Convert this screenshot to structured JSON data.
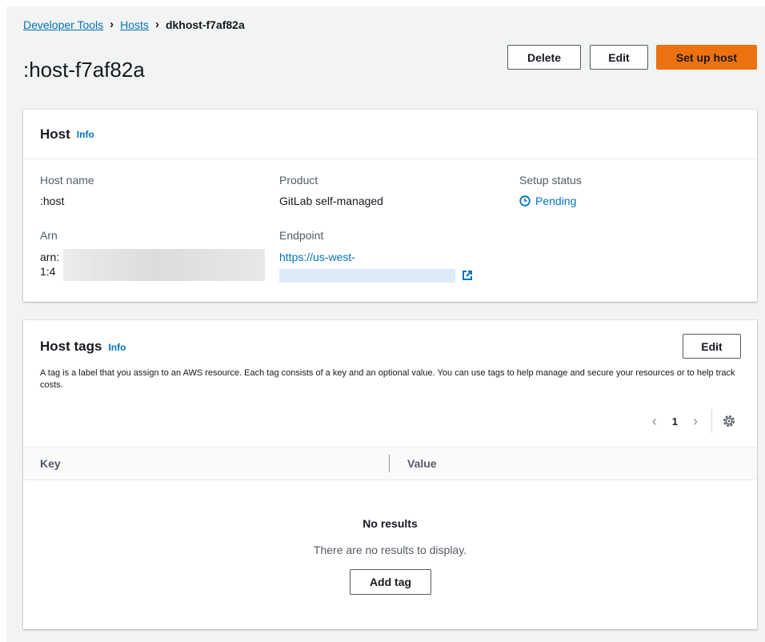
{
  "breadcrumb": {
    "items": [
      "Developer Tools",
      "Hosts"
    ],
    "current": "dkhost-f7af82a"
  },
  "page": {
    "title": ":host-f7af82a",
    "delete_label": "Delete",
    "edit_label": "Edit",
    "setup_label": "Set up host"
  },
  "host_panel": {
    "title": "Host",
    "info": "Info",
    "host_name_label": "Host name",
    "host_name_value": ":host",
    "product_label": "Product",
    "product_value": "GitLab self-managed",
    "setup_status_label": "Setup status",
    "setup_status_value": "Pending",
    "arn_label": "Arn",
    "arn_line1": "arn:",
    "arn_line2": "1:4 ",
    "endpoint_label": "Endpoint",
    "endpoint_value": "https://us-west-"
  },
  "tags_panel": {
    "title": "Host tags",
    "info": "Info",
    "edit_label": "Edit",
    "description": "A tag is a label that you assign to an AWS resource. Each tag consists of a key and an optional value. You can use tags to help manage and secure your resources or to help track costs.",
    "page_number": "1",
    "columns": [
      "Key",
      "Value"
    ],
    "empty_title": "No results",
    "empty_desc": "There are no results to display.",
    "add_tag_label": "Add tag"
  },
  "colors": {
    "primary_button": "#ec7211",
    "link": "#0073bb",
    "background": "#f2f3f3"
  },
  "icons": {
    "breadcrumb_separator": "chevron-right-icon",
    "status": "clock-icon",
    "external_link": "external-link-icon",
    "pager_prev": "chevron-left-icon",
    "pager_next": "chevron-right-icon",
    "preferences": "gear-icon"
  }
}
